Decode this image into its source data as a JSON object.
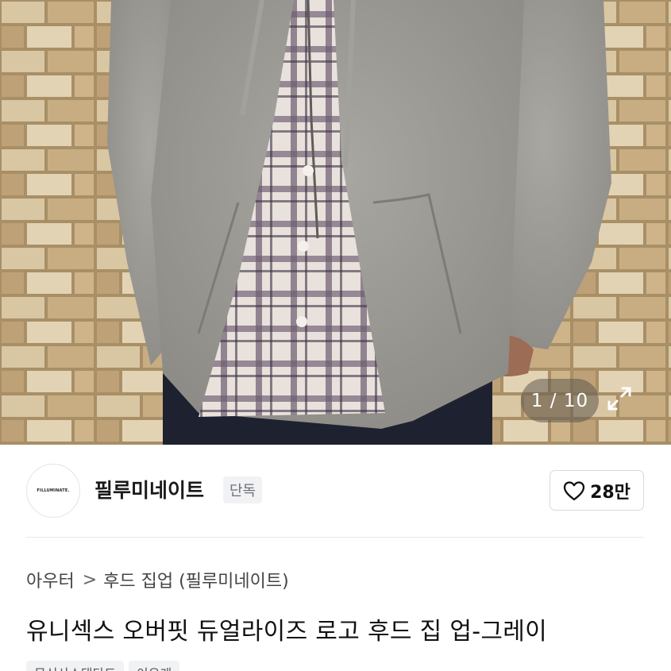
{
  "gallery": {
    "counter": "1 / 10",
    "expand_icon": "expand-arrows-icon"
  },
  "brand": {
    "logo_text": "FILLUMINATE.",
    "name": "필루미네이트",
    "badge": "단독"
  },
  "like": {
    "icon": "heart-outline-icon",
    "count": "28만"
  },
  "breadcrumb": {
    "category": "아우터",
    "separator": ">",
    "subcategory": "후드 집업 (필루미네이트)"
  },
  "product": {
    "title": "유니섹스 오버핏 듀얼라이즈 로고 후드 집 업-그레이"
  },
  "tags": [
    {
      "label": "무신사스탠다드"
    },
    {
      "label": "이유게"
    }
  ],
  "colors": {
    "badge_bg": "#f1f2f4",
    "badge_text": "#6c7079",
    "counter_bg": "rgba(95,90,80,0.55)",
    "hoodie_gray": "#9a9893"
  }
}
